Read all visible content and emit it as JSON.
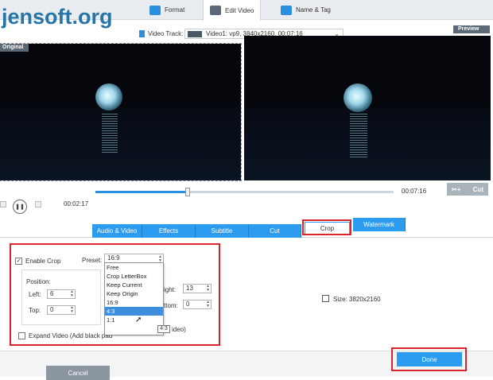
{
  "watermark": "jensoft.org",
  "tabs": [
    {
      "label": "Format",
      "icon": "format-icon"
    },
    {
      "label": "Edit Video",
      "icon": "edit-video-icon"
    },
    {
      "label": "Name & Tag",
      "icon": "name-tag-icon"
    }
  ],
  "video_track": {
    "label": "Video Track:",
    "value": "Video1: vp9, 3840x2160, 00:07:16"
  },
  "labels": {
    "original": "Original",
    "preview": "Preview"
  },
  "playback": {
    "current_time": "00:02:17",
    "total_time": "00:07:16",
    "progress": 0.31,
    "cut_label": "Cut"
  },
  "function_tabs": [
    {
      "label": "Audio & Video"
    },
    {
      "label": "Effects"
    },
    {
      "label": "Subtitle"
    },
    {
      "label": "Cut"
    },
    {
      "label": "Crop",
      "active": true
    },
    {
      "label": "Watermark"
    }
  ],
  "crop": {
    "enable_label": "Enable Crop",
    "enable_checked": "✓",
    "preset_label": "Preset:",
    "preset_value": "16:9",
    "position_label": "Position:",
    "left_label": "Left:",
    "left_value": "6",
    "top_label": "Top:",
    "top_value": "0",
    "height_label_partial": "ight:",
    "height_value": "13",
    "bottom_label_partial": "ttom:",
    "bottom_value": "0",
    "size_label": "Size:",
    "size_value": "3820x2160",
    "expand_label_a": "Expand Video (Add black pad",
    "expand_label_b": "ideo)",
    "preset_options": [
      "Free",
      "Crop LetterBox",
      "Keep Current",
      "Keep Origin",
      "16:9",
      "4:3",
      "1:1"
    ],
    "hovered_option": "4:3",
    "tooltip": "4:3"
  },
  "buttons": {
    "cancel": "Cancel",
    "done": "Done"
  },
  "colors": {
    "accent": "#2b9cf0",
    "highlight_box": "#d9262e"
  }
}
